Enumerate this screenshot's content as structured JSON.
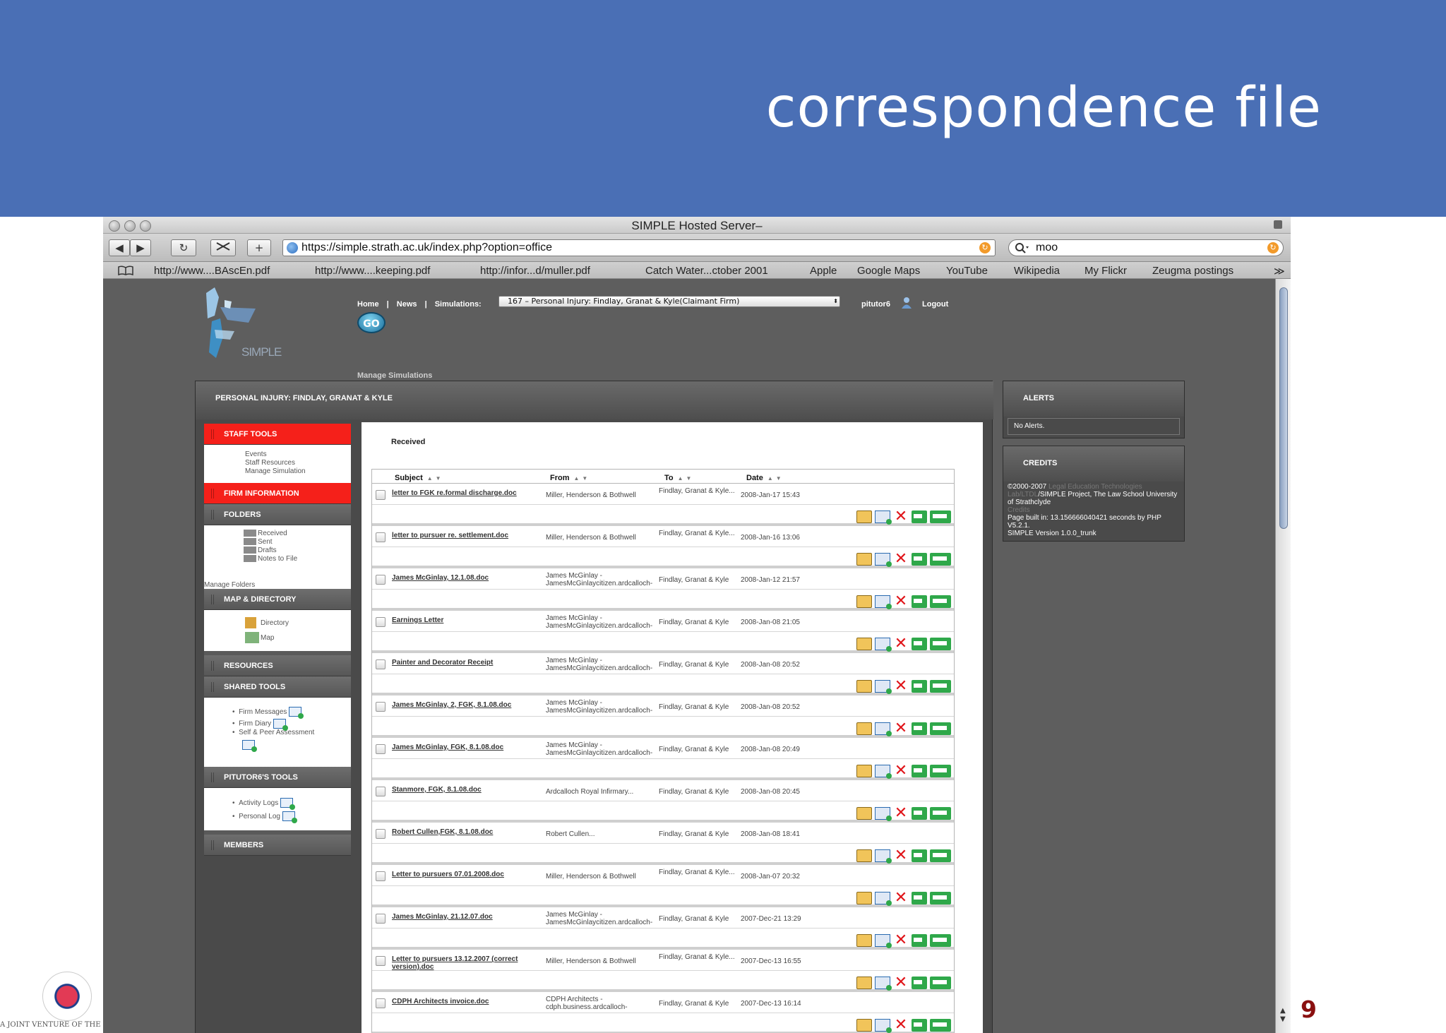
{
  "slide": {
    "title": "correspondence file",
    "page_number": "9",
    "footer_text": "A JOINT VENTURE OF THE UNI"
  },
  "browser": {
    "window_title": "SIMPLE Hosted Server–",
    "url": "https://simple.strath.ac.uk/index.php?option=office",
    "search_value": "moo",
    "toolbar": {
      "back": "◀",
      "forward": "▶",
      "reload": "↻",
      "add": "+"
    },
    "bookmarks": [
      "http://www....BAscEn.pdf",
      "http://www....keeping.pdf",
      "http://infor...d/muller.pdf",
      "Catch Water...ctober 2001",
      "Apple",
      "Google Maps",
      "YouTube",
      "Wikipedia",
      "My Flickr",
      "Zeugma postings"
    ],
    "bookmarks_more": "≫"
  },
  "app": {
    "logo_text": "SIMPLE",
    "nav": {
      "home": "Home",
      "news": "News",
      "simulations_label": "Simulations:",
      "sep": "|"
    },
    "simulation_selected": "167 – Personal Injury: Findlay, Granat & Kyle(Claimant Firm)",
    "go": "GO",
    "username": "pitutor6",
    "logout": "Logout",
    "manage_simulations": "Manage Simulations",
    "panel_title": "PERSONAL INJURY: FINDLAY, GRANAT & KYLE"
  },
  "sidebar": {
    "staff_tools": "STAFF TOOLS",
    "staff_items": [
      "Events",
      "Staff Resources",
      "Manage Simulation"
    ],
    "firm_information": "FIRM INFORMATION",
    "folders": "FOLDERS",
    "folder_items": [
      "Received",
      "Sent",
      "Drafts",
      "Notes to File"
    ],
    "manage_folders": "Manage Folders",
    "map_directory": "MAP & DIRECTORY",
    "map_items": [
      "Directory",
      "Map"
    ],
    "resources": "RESOURCES",
    "shared_tools": "SHARED TOOLS",
    "shared_items": [
      "Firm Messages",
      "Firm Diary",
      "Self & Peer Assessment"
    ],
    "pitutor_tools": "PITUTOR6'S TOOLS",
    "pitutor_items": [
      "Activity Logs",
      "Personal Log"
    ],
    "members": "MEMBERS"
  },
  "content": {
    "folder_name": "Received",
    "columns": {
      "subject": "Subject",
      "from": "From",
      "to": "To",
      "date": "Date"
    },
    "rows": [
      {
        "subject": "letter to FGK re.formal discharge.doc",
        "from": "Miller, Henderson & Bothwell",
        "to": "Findlay, Granat & Kyle...",
        "date": "2008-Jan-17 15:43"
      },
      {
        "subject": "letter to pursuer re. settlement.doc",
        "from": "Miller, Henderson & Bothwell",
        "to": "Findlay, Granat & Kyle...",
        "date": "2008-Jan-16 13:06"
      },
      {
        "subject": "James McGinlay, 12.1.08.doc",
        "from": "James McGinlay - JamesMcGinlaycitizen.ardcalloch-",
        "to": "Findlay, Granat & Kyle",
        "date": "2008-Jan-12 21:57"
      },
      {
        "subject": "Earnings Letter",
        "from": "James McGinlay - JamesMcGinlaycitizen.ardcalloch-",
        "to": "Findlay, Granat & Kyle",
        "date": "2008-Jan-08 21:05"
      },
      {
        "subject": "Painter and Decorator Receipt",
        "from": "James McGinlay - JamesMcGinlaycitizen.ardcalloch-",
        "to": "Findlay, Granat & Kyle",
        "date": "2008-Jan-08 20:52"
      },
      {
        "subject": "James McGinlay, 2, FGK, 8.1.08.doc",
        "from": "James McGinlay - JamesMcGinlaycitizen.ardcalloch-",
        "to": "Findlay, Granat & Kyle",
        "date": "2008-Jan-08 20:52"
      },
      {
        "subject": "James McGinlay, FGK, 8.1.08.doc",
        "from": "James McGinlay - JamesMcGinlaycitizen.ardcalloch-",
        "to": "Findlay, Granat & Kyle",
        "date": "2008-Jan-08 20:49"
      },
      {
        "subject": "Stanmore, FGK, 8.1.08.doc",
        "from": "Ardcalloch Royal Infirmary...",
        "to": "Findlay, Granat & Kyle",
        "date": "2008-Jan-08 20:45"
      },
      {
        "subject": "Robert Cullen,FGK, 8.1.08.doc",
        "from": "Robert Cullen...",
        "to": "Findlay, Granat & Kyle",
        "date": "2008-Jan-08 18:41"
      },
      {
        "subject": "Letter to pursuers 07.01.2008.doc",
        "from": "Miller, Henderson & Bothwell",
        "to": "Findlay, Granat & Kyle...",
        "date": "2008-Jan-07 20:32"
      },
      {
        "subject": "James McGinlay, 21.12.07.doc",
        "from": "James McGinlay - JamesMcGinlaycitizen.ardcalloch-",
        "to": "Findlay, Granat & Kyle",
        "date": "2007-Dec-21 13:29"
      },
      {
        "subject": "Letter to pursuers 13.12.2007 (correct version).doc",
        "from": "Miller, Henderson & Bothwell",
        "to": "Findlay, Granat & Kyle...",
        "date": "2007-Dec-13 16:55"
      },
      {
        "subject": "CDPH Architects invoice.doc",
        "from": "CDPH Architects - cdph.business.ardcalloch-",
        "to": "Findlay, Granat & Kyle",
        "date": "2007-Dec-13 16:14"
      }
    ],
    "action_icons": [
      "view-icon",
      "forward-icon",
      "delete-icon",
      "move-icon",
      "copy-icon"
    ]
  },
  "alerts": {
    "title": "ALERTS",
    "message": "No Alerts."
  },
  "credits": {
    "title": "CREDITS",
    "line1": "©2000-2007 ",
    "faded1": "Legal Education Technologies Lab/LTDL",
    "line1b": "/SIMPLE Project, The Law School University of Strathclyde",
    "faded2": "Credits",
    "line2": "Page built in: 13.156666040421 seconds by PHP V5.2.1.",
    "line3": "SIMPLE Version 1.0.0_trunk"
  },
  "colors": {
    "slide_header": "#4a6fb5",
    "sidebar_active": "#f5201a",
    "page_number": "#8a1010"
  }
}
